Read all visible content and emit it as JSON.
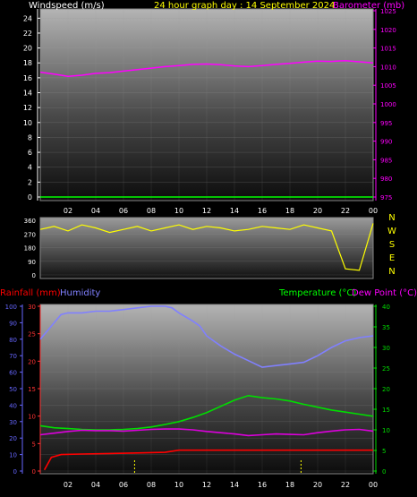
{
  "chart_data": [
    {
      "type": "line",
      "title": "24 hour graph day : 14 September 2024",
      "ylabel_left": "Windspeed (m/s)",
      "ylabel_right": "Barometer (mb)",
      "x_ticks": [
        "02",
        "04",
        "06",
        "08",
        "10",
        "12",
        "14",
        "16",
        "18",
        "20",
        "22",
        "00"
      ],
      "y_left_ticks": [
        "0",
        "2",
        "4",
        "6",
        "8",
        "10",
        "12",
        "14",
        "16",
        "18",
        "20",
        "22",
        "24"
      ],
      "y_right_ticks": [
        "975",
        "980",
        "985",
        "990",
        "995",
        "1000",
        "1005",
        "1010",
        "1015",
        "1020",
        "1025"
      ],
      "ylim_left": [
        0,
        25
      ],
      "ylim_right": [
        975,
        1025
      ],
      "series": [
        {
          "axis": "right",
          "color": "#ff00ff",
          "x": [
            0,
            1,
            2,
            3,
            4,
            5,
            6,
            7,
            8,
            9,
            10,
            11,
            12,
            13,
            14,
            15,
            16,
            17,
            18,
            19,
            20,
            21,
            22,
            23,
            24
          ],
          "values": [
            1008.5,
            1008.0,
            1007.4,
            1007.7,
            1008.2,
            1008.4,
            1008.8,
            1009.2,
            1009.6,
            1010.0,
            1010.3,
            1010.6,
            1010.7,
            1010.5,
            1010.2,
            1010.0,
            1010.3,
            1010.6,
            1010.9,
            1011.2,
            1011.5,
            1011.4,
            1011.6,
            1011.3,
            1011.0
          ]
        },
        {
          "axis": "left",
          "color": "#00ff00",
          "x": [
            0,
            24
          ],
          "values": [
            0,
            0
          ]
        }
      ]
    },
    {
      "type": "scatter",
      "y_left_ticks": [
        "0",
        "90",
        "180",
        "270",
        "360"
      ],
      "ylim": [
        0,
        360
      ],
      "right_labels": [
        "N",
        "W",
        "S",
        "E",
        "N"
      ],
      "series": [
        {
          "color": "#ffff00",
          "x": [
            0,
            1,
            2,
            3,
            4,
            5,
            6,
            7,
            8,
            9,
            10,
            11,
            12,
            13,
            14,
            15,
            16,
            17,
            18,
            19,
            20,
            21,
            22,
            23,
            24
          ],
          "values": [
            300,
            320,
            290,
            330,
            310,
            280,
            300,
            320,
            290,
            310,
            330,
            300,
            320,
            310,
            290,
            300,
            320,
            310,
            300,
            330,
            310,
            290,
            40,
            30,
            340
          ]
        }
      ]
    },
    {
      "type": "line",
      "ylabel_rainfall": "Rainfall (mm)",
      "ylabel_humidity": "Humidity",
      "ylabel_temperature": "Temperature (°C)",
      "ylabel_dewpoint": "Dew Point (°C)",
      "humidity_ticks": [
        "0",
        "10",
        "20",
        "30",
        "40",
        "50",
        "60",
        "70",
        "80",
        "90",
        "100"
      ],
      "rainfall_ticks": [
        "0",
        "5",
        "10",
        "15",
        "20",
        "25",
        "30"
      ],
      "right_ticks": [
        "0",
        "5",
        "10",
        "15",
        "20",
        "25",
        "30",
        "35",
        "40"
      ],
      "ylim_humidity": [
        0,
        100
      ],
      "ylim_rainfall": [
        0,
        30
      ],
      "ylim_right": [
        0,
        40
      ],
      "series": [
        {
          "name": "Humidity",
          "axis": "humidity",
          "color": "#8080ff",
          "x": [
            0,
            0.5,
            1,
            1.5,
            2,
            3,
            4,
            5,
            6,
            7,
            8,
            9,
            9.5,
            10,
            11,
            11.5,
            12,
            13,
            14,
            15,
            16,
            17,
            18,
            19,
            20,
            21,
            22,
            23,
            24
          ],
          "values": [
            80,
            85,
            90,
            95,
            96,
            96,
            97,
            97,
            98,
            99,
            100,
            100,
            99,
            96,
            91,
            88,
            82,
            76,
            71,
            67,
            63,
            64,
            65,
            66,
            70,
            75,
            79,
            81,
            82
          ]
        },
        {
          "name": "Temperature",
          "axis": "right",
          "color": "#00dd00",
          "x": [
            0,
            1,
            2,
            3,
            4,
            5,
            6,
            7,
            8,
            9,
            10,
            11,
            12,
            13,
            14,
            15,
            16,
            17,
            18,
            19,
            20,
            21,
            22,
            23,
            24
          ],
          "values": [
            11,
            10.5,
            10.3,
            10.1,
            10,
            10,
            10.1,
            10.3,
            10.7,
            11.3,
            12,
            13,
            14.2,
            15.7,
            17.2,
            18.3,
            17.8,
            17.5,
            17,
            16.2,
            15.5,
            14.8,
            14.3,
            13.8,
            13.3
          ]
        },
        {
          "name": "Dew Point",
          "axis": "right",
          "color": "#dd00dd",
          "x": [
            0,
            1,
            2,
            3,
            4,
            5,
            6,
            7,
            8,
            9,
            10,
            11,
            12,
            13,
            14,
            15,
            16,
            17,
            18,
            19,
            20,
            21,
            22,
            23,
            24
          ],
          "values": [
            8.8,
            9.2,
            9.6,
            9.9,
            9.8,
            9.8,
            9.7,
            9.9,
            10.1,
            10.2,
            10.2,
            10,
            9.6,
            9.3,
            9,
            8.6,
            8.8,
            9,
            8.9,
            8.8,
            9.3,
            9.7,
            10,
            10.1,
            9.7
          ]
        },
        {
          "name": "Rainfall",
          "axis": "rainfall",
          "color": "#ff0000",
          "x": [
            0.3,
            0.8,
            1.5,
            3,
            5,
            7,
            9,
            10,
            11,
            13,
            15,
            17,
            19,
            21,
            23,
            24
          ],
          "values": [
            0.2,
            2.5,
            3.0,
            3.1,
            3.2,
            3.3,
            3.4,
            3.8,
            3.8,
            3.8,
            3.8,
            3.8,
            3.8,
            3.8,
            3.8,
            3.8
          ]
        }
      ]
    }
  ],
  "text": {
    "windspeed_label": "Windspeed (m/s)",
    "title": "24 hour graph day : 14 September 2024",
    "barometer_label": "Barometer (mb)",
    "rainfall_label": "Rainfall (mm)",
    "humidity_label": "Humidity",
    "temperature_label": "Temperature (°C)",
    "dewpoint_label": "Dew Point (°C)"
  },
  "colors": {
    "windspeed": "#ffffff",
    "title": "#ffff00",
    "barometer": "#ff00ff",
    "rainfall": "#ff0000",
    "humidity": "#8080ff",
    "temperature": "#00ff00",
    "dewpoint": "#ff00ff",
    "axis_left": "#ffffff",
    "axis_right_baro": "#ff00ff",
    "humidity_axis": "#6666ff",
    "rain_axis": "#ff3333",
    "temp_axis": "#00dd00",
    "direction": "#ffff00"
  }
}
